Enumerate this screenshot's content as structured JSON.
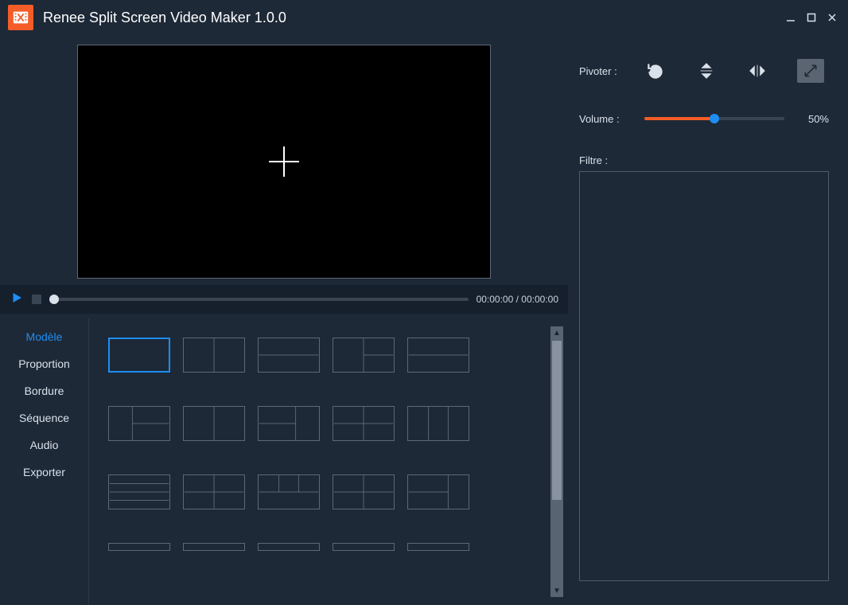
{
  "titlebar": {
    "title": "Renee Split Screen Video Maker 1.0.0"
  },
  "player": {
    "timecode": "00:00:00 / 00:00:00"
  },
  "tabs": [
    {
      "id": "modele",
      "label": "Modèle",
      "active": true
    },
    {
      "id": "proportion",
      "label": "Proportion",
      "active": false
    },
    {
      "id": "bordure",
      "label": "Bordure",
      "active": false
    },
    {
      "id": "sequence",
      "label": "Séquence",
      "active": false
    },
    {
      "id": "audio",
      "label": "Audio",
      "active": false
    },
    {
      "id": "exporter",
      "label": "Exporter",
      "active": false
    }
  ],
  "templates": {
    "selected_index": 0,
    "items": [
      {
        "name": "1x1"
      },
      {
        "name": "1x2-v"
      },
      {
        "name": "2x1-h"
      },
      {
        "name": "1+2r"
      },
      {
        "name": "2x1-h-b"
      },
      {
        "name": "L-3a"
      },
      {
        "name": "1x2-v-b"
      },
      {
        "name": "L-3b"
      },
      {
        "name": "2x2"
      },
      {
        "name": "1x3-v"
      },
      {
        "name": "4x1-h"
      },
      {
        "name": "2+2"
      },
      {
        "name": "T-4"
      },
      {
        "name": "2x2-b"
      },
      {
        "name": "3x1+1"
      },
      {
        "name": "row4a"
      },
      {
        "name": "row4b"
      },
      {
        "name": "row4c"
      },
      {
        "name": "row4d"
      },
      {
        "name": "row4e"
      }
    ]
  },
  "right": {
    "rotate_label": "Pivoter :",
    "volume_label": "Volume :",
    "volume_value": "50%",
    "filter_label": "Filtre :"
  }
}
